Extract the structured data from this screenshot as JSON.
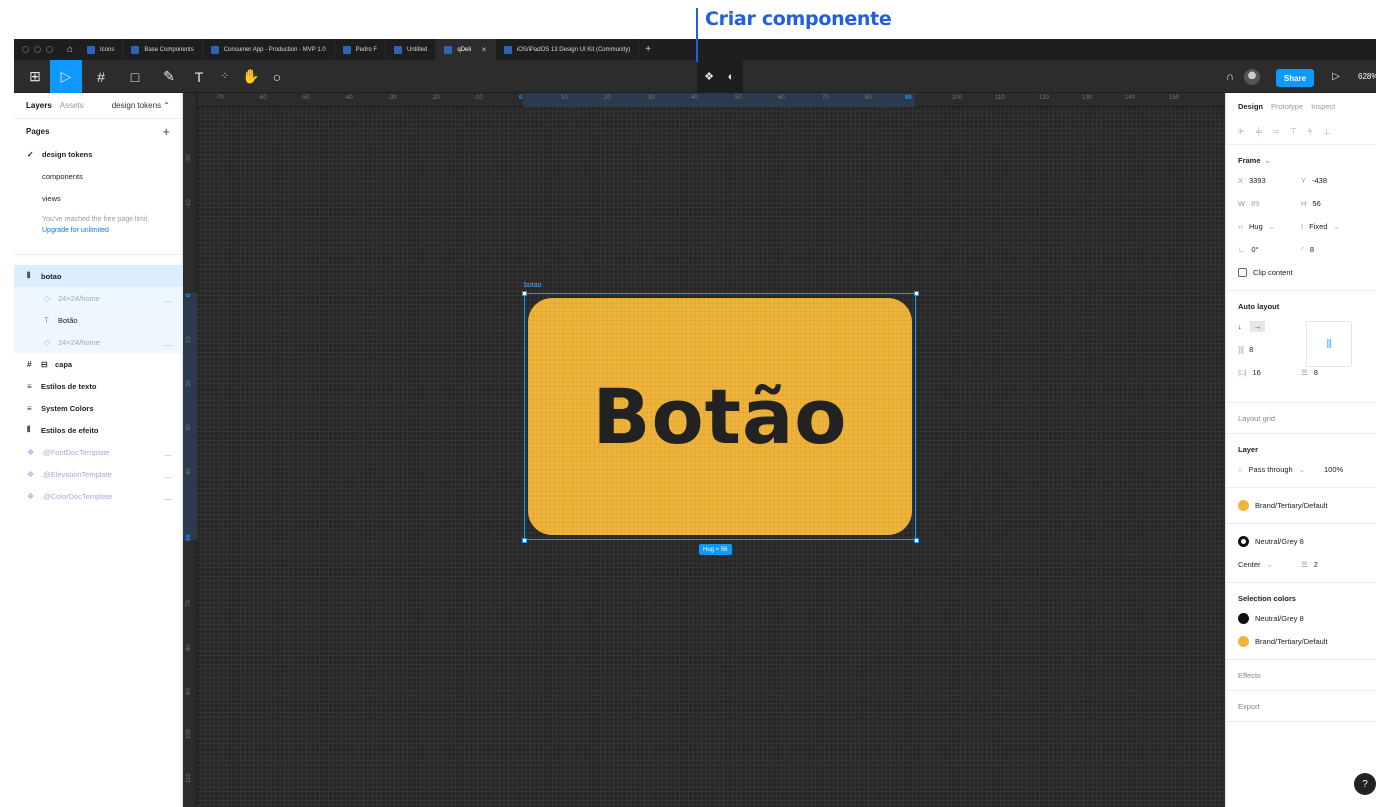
{
  "annotation": {
    "text": "Criar componente"
  },
  "tabs": [
    {
      "label": "Icons"
    },
    {
      "label": "Base Components"
    },
    {
      "label": "Consumer App - Production - MVP 1.0"
    },
    {
      "label": "Pedro F"
    },
    {
      "label": "Untitled"
    },
    {
      "label": "qDeli",
      "active": true
    },
    {
      "label": "iOS/iPadOS 13 Design UI Kit (Community)"
    }
  ],
  "toolbar": {
    "share_label": "Share",
    "zoom": "628%"
  },
  "left_panel": {
    "tab_layers": "Layers",
    "tab_assets": "Assets",
    "current_page": "design tokens",
    "pages_title": "Pages",
    "pages": [
      "design tokens",
      "components",
      "views"
    ],
    "limit_text": "You've reached the free page limit.",
    "upgrade_text": "Upgrade for unlimited",
    "layers": [
      {
        "label": "botao"
      },
      {
        "label": "24×24/home"
      },
      {
        "label": "Botão"
      },
      {
        "label": "24×24/home"
      },
      {
        "label": "capa"
      },
      {
        "label": "Estilos de texto"
      },
      {
        "label": "System Colors"
      },
      {
        "label": "Estilos de efeito"
      },
      {
        "label": ".@FontDocTemplate"
      },
      {
        "label": ".@ElevationTemplate"
      },
      {
        "label": ".@ColorDocTemplate"
      }
    ]
  },
  "ruler": {
    "top": [
      "-70",
      "-60",
      "-50",
      "-40",
      "-30",
      "-20",
      "-10",
      "0",
      "10",
      "20",
      "30",
      "40",
      "50",
      "60",
      "70",
      "80",
      "89",
      "100",
      "110",
      "120",
      "130",
      "140",
      "150"
    ],
    "left": [
      "-10",
      "-20",
      "-30",
      "-40",
      "0",
      "10",
      "20",
      "30",
      "40",
      "56",
      "70",
      "80",
      "90",
      "100",
      "110"
    ]
  },
  "canvas": {
    "frame_name": "botao",
    "button_text": "Botão",
    "size_tag": "Hug × 56",
    "button_color": "#f0b43a"
  },
  "right_panel": {
    "tab_design": "Design",
    "tab_prototype": "Prototype",
    "tab_inspect": "Inspect",
    "frame_title": "Frame",
    "x_label": "X",
    "x_value": "3393",
    "y_label": "Y",
    "y_value": "-438",
    "w_label": "W",
    "w_value": "89",
    "h_label": "H",
    "h_value": "56",
    "hug_value": "Hug",
    "fixed_value": "Fixed",
    "rotation_value": "0°",
    "radius_value": "8",
    "clip_label": "Clip content",
    "auto_layout_title": "Auto layout",
    "spacing_value": "8",
    "padding_h_value": "16",
    "padding_v_value": "8",
    "layout_grid_title": "Layout grid",
    "layer_title": "Layer",
    "blend_value": "Pass through",
    "opacity_value": "100%",
    "fill_style": "Brand/Tertiary/Default",
    "stroke_style": "Neutral/Grey 8",
    "stroke_align": "Center",
    "stroke_weight": "2",
    "selection_colors_title": "Selection colors",
    "selection_colors": [
      "Neutral/Grey 8",
      "Brand/Tertiary/Default"
    ],
    "effects_title": "Effects",
    "export_title": "Export",
    "colors": {
      "brand_tertiary": "#f0b43a",
      "neutral_grey8": "#111111"
    }
  }
}
